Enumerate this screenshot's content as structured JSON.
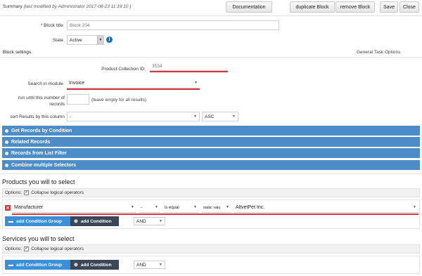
{
  "toolbar": {
    "summary_label": "Summary",
    "summary_meta": "(last modified by Administrator 2017-08-23 11:19:10 )",
    "documentation": "Documentation",
    "duplicate": "duplicate Block",
    "remove": "remove Block",
    "save": "Save",
    "close": "Close"
  },
  "form": {
    "block_title_label": "Block title",
    "block_title_value": "Block 204",
    "state_label": "State",
    "state_value": "Active",
    "block_settings": "Block settings",
    "general_task_options": "General Task Options",
    "product_collection_label": "Product Collection ID:",
    "product_collection_value": "3534",
    "search_module_label": "Search in module",
    "search_module_value": "Invoice",
    "run_until_label_1": "run until this number of",
    "run_until_label_2": "records",
    "run_until_hint": "(leave empty for all results)",
    "sort_label": "sort Results by this column",
    "sort_value": "-",
    "sort_dir": "ASC"
  },
  "panels": [
    "Get Records by Condition",
    "Related Records",
    "Records from List Filter",
    "Combine multiple Selectors"
  ],
  "products": {
    "title": "Products you will to select",
    "options_label": "Options:",
    "collapse_label": "Collapse logical operators",
    "condition": {
      "field": "Manufacturer",
      "modifier": "-",
      "operator": "is equal",
      "value_type": "static valu",
      "value": "AltvetPet Inc."
    },
    "add_group": "add Condition Group",
    "add_condition": "add Condition",
    "join": "AND"
  },
  "services": {
    "title": "Services you will to select",
    "options_label": "Options:",
    "collapse_label": "Collapse logical operators",
    "add_group": "add Condition Group",
    "add_condition": "add Condition",
    "join": "AND"
  },
  "colors": {
    "accent_bar": "#4b8cc9",
    "btn_blue": "#3a8fd6",
    "btn_dark": "#3b4656",
    "error_red": "#d9363e"
  }
}
